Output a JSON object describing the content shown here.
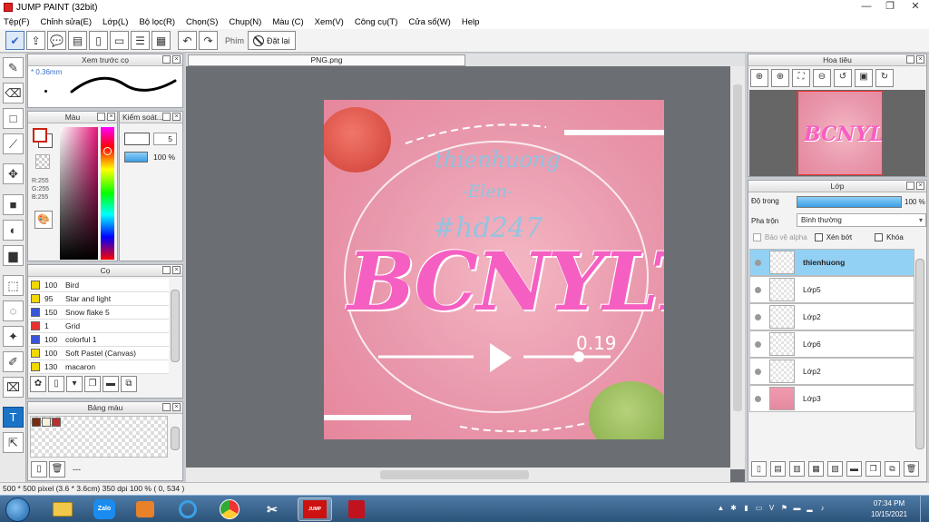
{
  "window": {
    "title": "JUMP PAINT (32bit)",
    "minimize": "—",
    "maximize": "❐",
    "close": "✕"
  },
  "menu": [
    "Tệp(F)",
    "Chỉnh sửa(E)",
    "Lớp(L)",
    "Bộ lọc(R)",
    "Chọn(S)",
    "Chụp(N)",
    "Màu (C)",
    "Xem(V)",
    "Công cụ(T)",
    "Cửa sổ(W)",
    "Help"
  ],
  "toolbar": {
    "shortcut_label": "Phím",
    "reset_label": "Đặt lại"
  },
  "brush_preview": {
    "title": "Xem trước cọ",
    "size": "* 0.36mm"
  },
  "color_panel": {
    "title": "Màu",
    "rgb": [
      "R:255",
      "G:255",
      "B:255"
    ]
  },
  "control_panel": {
    "title": "Kiểm soát...",
    "size_value": "5",
    "opacity_value": "100 %"
  },
  "brush_panel": {
    "title": "Cọ",
    "items": [
      {
        "value": "100",
        "name": "Bird",
        "color": "#f0d800"
      },
      {
        "value": "95",
        "name": "Star and light",
        "color": "#f0d800"
      },
      {
        "value": "150",
        "name": "Snow flake 5",
        "color": "#3a56d8"
      },
      {
        "value": "1",
        "name": "Grid",
        "color": "#e83030"
      },
      {
        "value": "100",
        "name": "colorful 1",
        "color": "#3a56d8"
      },
      {
        "value": "100",
        "name": "Soft Pastel (Canvas)",
        "color": "#f0d800"
      },
      {
        "value": "130",
        "name": "macaron",
        "color": "#f0d800"
      }
    ]
  },
  "palette_panel": {
    "title": "Bảng màu",
    "swatches": [
      "#7a2a10",
      "#f6efd9",
      "#b83030"
    ],
    "extra": "---"
  },
  "canvas": {
    "tab_title": "PNG.png",
    "art": {
      "line1": "thienhuong",
      "line2": "-Elen-",
      "line3": "#hd247",
      "main": "BCNYLT",
      "version": "0.19"
    }
  },
  "navigator": {
    "title": "Hoa tiêu",
    "thumb_text": "BCNYLT"
  },
  "layer_panel": {
    "title": "Lớp",
    "opacity_label": "Độ trong",
    "opacity_value": "100 %",
    "opacity_fraction": 1.0,
    "blend_label": "Pha trộn",
    "blend_value": "Bình thường",
    "check_protect": "Bảo vệ alpha",
    "check_clip": "Xén bớt",
    "check_lock": "Khóa",
    "layers": [
      {
        "name": "thienhuong",
        "selected": true
      },
      {
        "name": "Lớp5",
        "selected": false
      },
      {
        "name": "Lớp2",
        "selected": false
      },
      {
        "name": "Lớp6",
        "selected": false
      },
      {
        "name": "Lớp2",
        "selected": false
      },
      {
        "name": "Lớp3",
        "selected": false
      }
    ]
  },
  "status": {
    "text": "500 * 500 pixel  (3.6 * 3.6cm)  350 dpi  100 %  ( 0, 534 )"
  },
  "taskbar": {
    "zalo": "Zalo",
    "jump": "JUMP PAINT",
    "clock_time": "07:34 PM",
    "clock_date": "10/15/2021"
  },
  "colors": {
    "accent": "#1a73c7",
    "selected_layer": "#93d1f4",
    "art_main": "#f65fc2"
  }
}
